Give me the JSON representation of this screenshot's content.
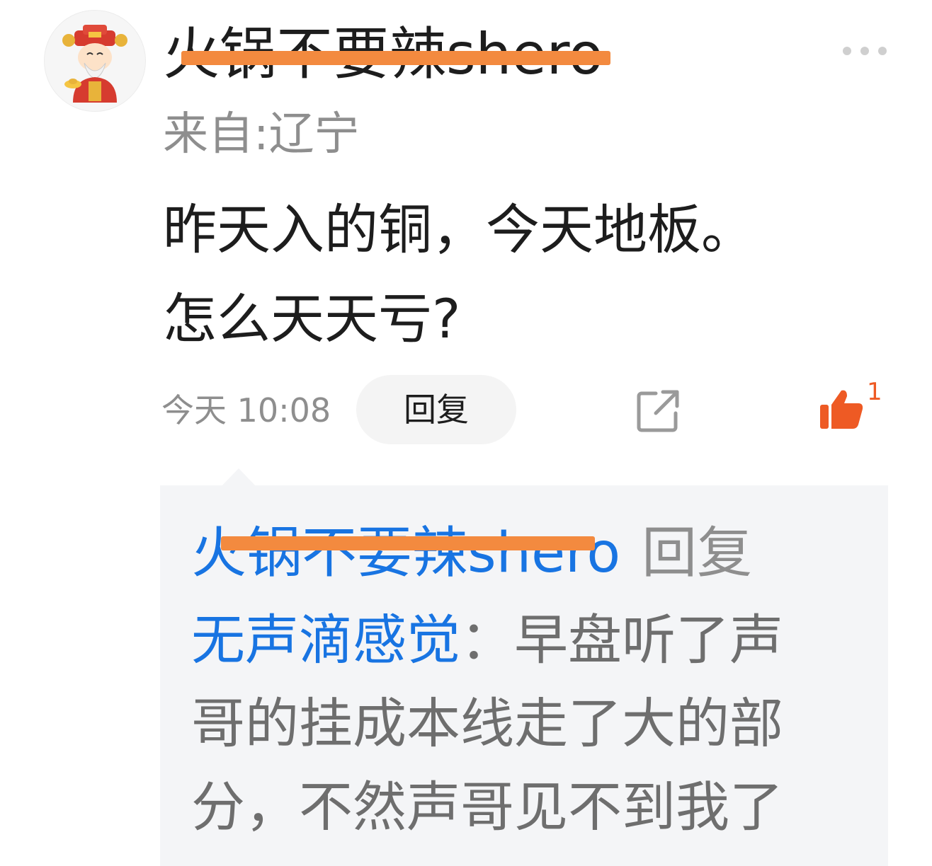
{
  "comment": {
    "username": "火锅不要辣shero",
    "location": "来自:辽宁",
    "text_line1": "昨天入的铜，今天地板。",
    "text_line2": "怎么天天亏?",
    "timestamp": "今天 10:08",
    "reply_label": "回复",
    "like_count": "1"
  },
  "sub_reply": {
    "from_user": "火锅不要辣shero",
    "reply_label": "回复",
    "mention_user": "无声滴感觉",
    "colon": "：",
    "text_part1": "早盘听了声",
    "text_line2": "哥的挂成本线走了大的部",
    "text_line3": "分，不然声哥见不到我了"
  },
  "icons": {
    "avatar": "caishen-avatar",
    "more": "more-dots-icon",
    "share": "share-icon",
    "like": "thumbs-up-icon"
  },
  "colors": {
    "link_blue": "#1874e2",
    "like_orange": "#ee5a24",
    "strike_orange": "#f38a3f",
    "muted_gray": "#8e8e8e"
  }
}
